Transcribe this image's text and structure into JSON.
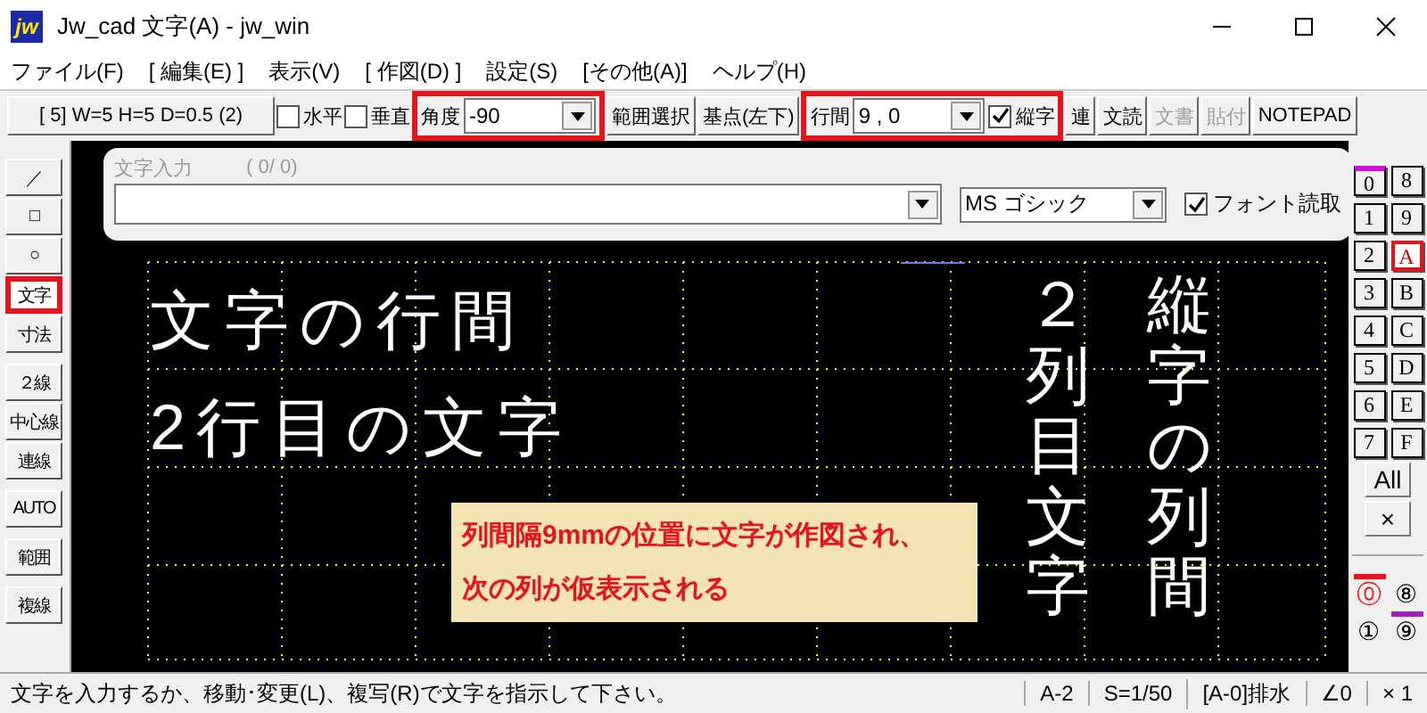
{
  "window": {
    "icon_text": "jw",
    "title": "Jw_cad 文字(A) - jw_win"
  },
  "menu": [
    "ファイル(F)",
    "[ 編集(E) ]",
    "表示(V)",
    "[ 作図(D) ]",
    "設定(S)",
    "[その他(A)]",
    "ヘルプ(H)"
  ],
  "toolbar": [
    {
      "kind": "button",
      "label": "[ 5]  W=5 H=5 D=0.5 (2)",
      "disabled": false
    },
    {
      "kind": "check",
      "label": "水平",
      "checked": false
    },
    {
      "kind": "check",
      "label": "垂直",
      "checked": false
    },
    {
      "kind": "combo",
      "label": "角度",
      "value": "-90",
      "highlighted": true
    },
    {
      "kind": "button",
      "label": "範囲選択",
      "disabled": false
    },
    {
      "kind": "button",
      "label": "基点(左下)",
      "disabled": false
    },
    {
      "kind": "combo",
      "label": "行間",
      "value": "9 , 0",
      "highlighted": true,
      "check": {
        "label": "縦字",
        "checked": true
      }
    },
    {
      "kind": "button",
      "label": "連",
      "disabled": false
    },
    {
      "kind": "button",
      "label": "文読",
      "disabled": false
    },
    {
      "kind": "button",
      "label": "文書",
      "disabled": true
    },
    {
      "kind": "button",
      "label": "貼付",
      "disabled": true
    },
    {
      "kind": "button",
      "label": "NOTEPAD",
      "disabled": false
    }
  ],
  "left_tools": [
    [
      {
        "label": "／",
        "selected": false
      },
      {
        "label": "□",
        "selected": false
      },
      {
        "label": "○",
        "selected": false
      },
      {
        "label": "文字",
        "selected": true
      },
      {
        "label": "寸法",
        "selected": false
      }
    ],
    [
      {
        "label": "２線",
        "selected": false
      },
      {
        "label": "中心線",
        "selected": false
      },
      {
        "label": "連線",
        "selected": false
      }
    ],
    [
      {
        "label": "AUTO",
        "selected": false
      }
    ],
    [
      {
        "label": "範囲",
        "selected": false
      }
    ],
    [
      {
        "label": "複線",
        "selected": false
      }
    ]
  ],
  "text_dialog": {
    "title": "文字入力",
    "counter": "( 0/  0)",
    "font": "MS ゴシック",
    "font_read": {
      "label": "フォント読取",
      "checked": true
    }
  },
  "canvas": {
    "horizontal_texts": [
      "文字の行間",
      "2行目の文字"
    ],
    "vertical_texts": [
      "２列目文字",
      "縦字の列間"
    ],
    "callout": [
      "列間隔9mmの位置に文字が作図され、",
      "次の列が仮表示される"
    ]
  },
  "layers": [
    {
      "label": "0",
      "selected": false,
      "marked": true
    },
    {
      "label": "8",
      "selected": false,
      "marked": false
    },
    {
      "label": "1",
      "selected": false,
      "marked": false
    },
    {
      "label": "9",
      "selected": false,
      "marked": false
    },
    {
      "label": "2",
      "selected": false,
      "marked": false
    },
    {
      "label": "A",
      "selected": true,
      "marked": false
    },
    {
      "label": "3",
      "selected": false,
      "marked": false
    },
    {
      "label": "B",
      "selected": false,
      "marked": false
    },
    {
      "label": "4",
      "selected": false,
      "marked": false
    },
    {
      "label": "C",
      "selected": false,
      "marked": false
    },
    {
      "label": "5",
      "selected": false,
      "marked": false
    },
    {
      "label": "D",
      "selected": false,
      "marked": false
    },
    {
      "label": "6",
      "selected": false,
      "marked": false
    },
    {
      "label": "E",
      "selected": false,
      "marked": false
    },
    {
      "label": "7",
      "selected": false,
      "marked": false
    },
    {
      "label": "F",
      "selected": false,
      "marked": false
    }
  ],
  "layer_buttons": [
    "All",
    "×"
  ],
  "layer_groups": [
    {
      "label": "⓪",
      "selected": true,
      "marked": false
    },
    {
      "label": "⑧",
      "selected": false,
      "marked": false
    },
    {
      "label": "①",
      "selected": false,
      "marked": false
    },
    {
      "label": "⑨",
      "selected": false,
      "marked": true
    }
  ],
  "status_bar": {
    "message": "文字を入力するか、移動･変更(L)、複写(R)で文字を指示して下さい。",
    "cells": [
      "A-2",
      "S=1/50",
      "[A-0]排水",
      "∠0",
      "× 1"
    ]
  }
}
